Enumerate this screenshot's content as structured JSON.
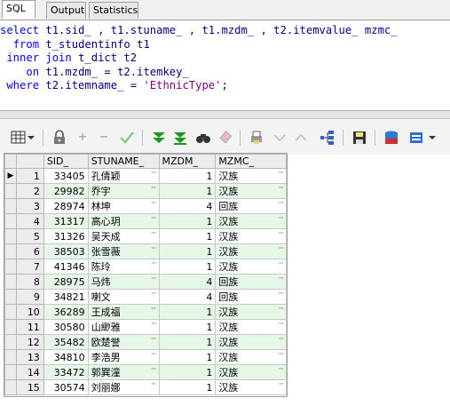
{
  "tabs": [
    {
      "label": "SQL",
      "active": true
    },
    {
      "label": "Output",
      "active": false
    },
    {
      "label": "Statistics",
      "active": false
    }
  ],
  "sql": {
    "line1": [
      "select",
      " t1.sid_ , t1.stuname_ , t1.mzdm_ , t2.itemvalue_ mzmc_"
    ],
    "line2": [
      "from",
      " t_studentinfo t1"
    ],
    "line3a": "inner",
    "line3b": "join",
    "line3c": " t_dict t2",
    "line4": [
      "on",
      " t1.mzdm_ = t2.itemkey_"
    ],
    "line5": [
      "where",
      " t2.itemname_ = ",
      "'EthnicType'",
      ";"
    ]
  },
  "toolbar": {
    "icons": [
      "grid-view-icon",
      "lock-icon",
      "add-row-icon",
      "delete-row-icon",
      "post-check-icon",
      "filter-down-icon",
      "filter-down-alt-icon",
      "find-icon",
      "clear-icon",
      "print-icon",
      "sort-down-icon",
      "sort-up-icon",
      "tree-icon",
      "save-icon",
      "export-icon",
      "database-icon"
    ]
  },
  "grid": {
    "columns": [
      "SID_",
      "STUNAME_",
      "MZDM_",
      "MZMC_"
    ],
    "rows": [
      {
        "n": "1",
        "sid": "33405",
        "name": "孔倩颖",
        "mzdm": "1",
        "mzmc": "汉族"
      },
      {
        "n": "2",
        "sid": "29982",
        "name": "乔宇",
        "mzdm": "1",
        "mzmc": "汉族"
      },
      {
        "n": "3",
        "sid": "28974",
        "name": "林坤",
        "mzdm": "4",
        "mzmc": "回族"
      },
      {
        "n": "4",
        "sid": "31317",
        "name": "高心玥",
        "mzdm": "1",
        "mzmc": "汉族"
      },
      {
        "n": "5",
        "sid": "31326",
        "name": "吴天成",
        "mzdm": "1",
        "mzmc": "汉族"
      },
      {
        "n": "6",
        "sid": "38503",
        "name": "张雪薇",
        "mzdm": "1",
        "mzmc": "汉族"
      },
      {
        "n": "7",
        "sid": "41346",
        "name": "陈玲",
        "mzdm": "1",
        "mzmc": "汉族"
      },
      {
        "n": "8",
        "sid": "28975",
        "name": "马炜",
        "mzdm": "4",
        "mzmc": "回族"
      },
      {
        "n": "9",
        "sid": "34821",
        "name": "喇文",
        "mzdm": "4",
        "mzmc": "回族"
      },
      {
        "n": "10",
        "sid": "36289",
        "name": "王成福",
        "mzdm": "1",
        "mzmc": "汉族"
      },
      {
        "n": "11",
        "sid": "30580",
        "name": "山緲雅",
        "mzdm": "1",
        "mzmc": "汉族"
      },
      {
        "n": "12",
        "sid": "35482",
        "name": "欧楚誉",
        "mzdm": "1",
        "mzmc": "汉族"
      },
      {
        "n": "13",
        "sid": "34810",
        "name": "李浩男",
        "mzdm": "1",
        "mzmc": "汉族"
      },
      {
        "n": "14",
        "sid": "33472",
        "name": "郭巽潼",
        "mzdm": "1",
        "mzmc": "汉族"
      },
      {
        "n": "15",
        "sid": "30574",
        "name": "刘丽娜",
        "mzdm": "1",
        "mzmc": "汉族"
      }
    ],
    "current_row_indicator": "▶",
    "ellipsis": "···"
  },
  "colors": {
    "keyword": "#0000ff",
    "identifier": "#000080",
    "string": "#800080",
    "alt_row": "#e7f7e7"
  }
}
